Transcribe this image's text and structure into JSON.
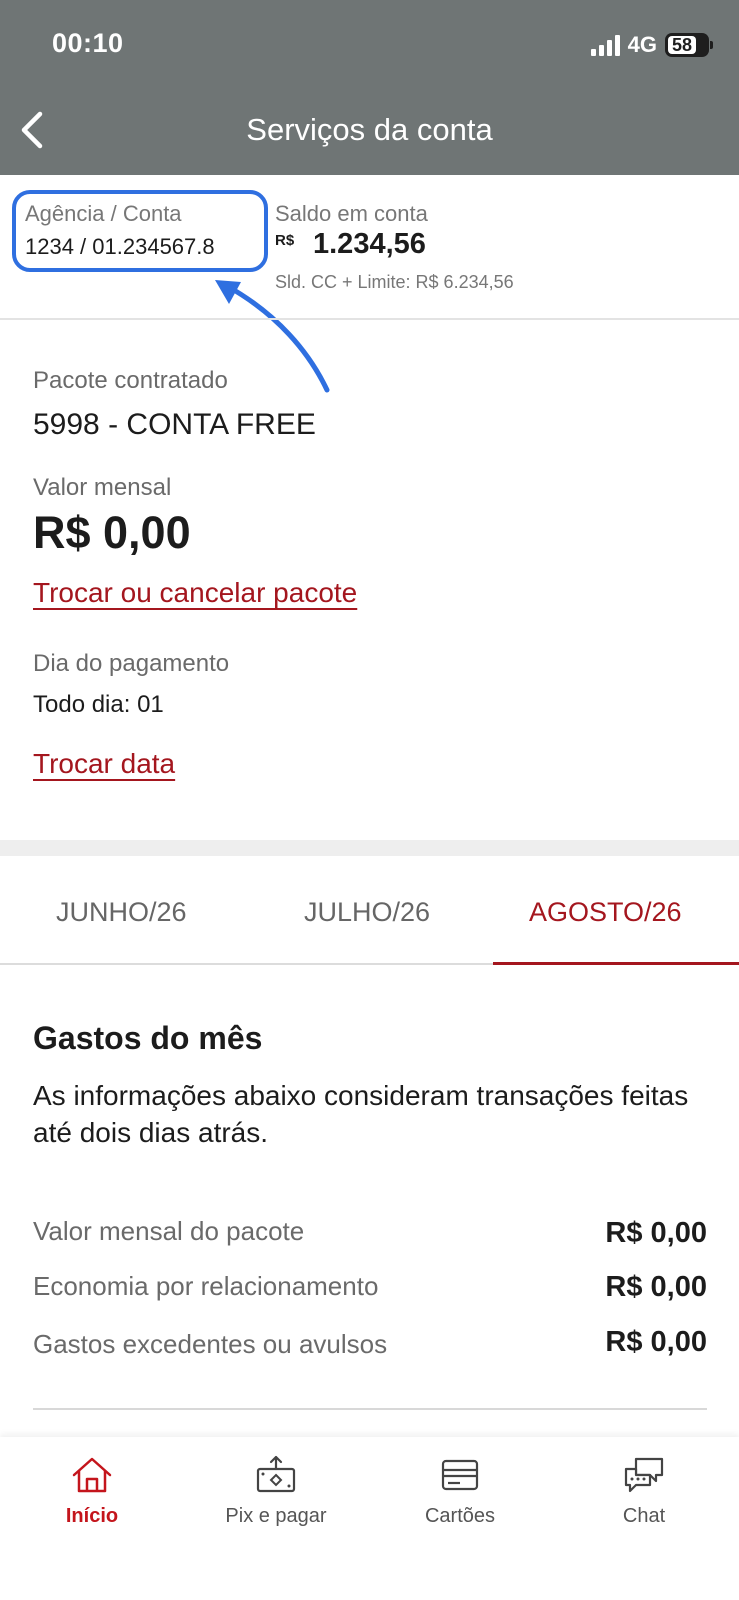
{
  "status_bar": {
    "time": "00:10",
    "network": "4G",
    "battery": "58"
  },
  "header": {
    "title": "Serviços da conta"
  },
  "account": {
    "agency_label": "Agência / Conta",
    "agency_value": "1234 / 01.234567.8",
    "balance_label": "Saldo em conta",
    "balance_currency": "R$",
    "balance_value": "1.234,56",
    "limit_text": "Sld. CC + Limite: R$  6.234,56",
    "highlight_color": "#2f6fe0"
  },
  "package": {
    "label": "Pacote contratado",
    "name": "5998 - CONTA FREE",
    "monthly_label": "Valor mensal",
    "monthly_value": "R$ 0,00",
    "change_link": "Trocar ou cancelar pacote",
    "payment_label": "Dia do pagamento",
    "payment_value": "Todo dia: 01",
    "change_date_link": "Trocar data"
  },
  "tabs": [
    {
      "label": "JUNHO/26",
      "active": false
    },
    {
      "label": "JULHO/26",
      "active": false
    },
    {
      "label": "AGOSTO/26",
      "active": true
    }
  ],
  "spending": {
    "title": "Gastos do mês",
    "description": "As informações abaixo consideram transações feitas até dois dias atrás.",
    "rows": [
      {
        "label": "Valor mensal do pacote",
        "value": "R$ 0,00"
      },
      {
        "label": "Economia por relacionamento",
        "value": "R$ 0,00"
      },
      {
        "label": "Gastos excedentes ou avulsos",
        "value": "R$ 0,00"
      }
    ]
  },
  "bottom_nav": [
    {
      "label": "Início",
      "icon": "home-icon",
      "active": true
    },
    {
      "label": "Pix e pagar",
      "icon": "pix-pay-icon",
      "active": false
    },
    {
      "label": "Cartões",
      "icon": "cards-icon",
      "active": false
    },
    {
      "label": "Chat",
      "icon": "chat-icon",
      "active": false
    }
  ],
  "colors": {
    "accent": "#a4161e",
    "header_bg": "#6f7575",
    "nav_active": "#c4151c"
  }
}
